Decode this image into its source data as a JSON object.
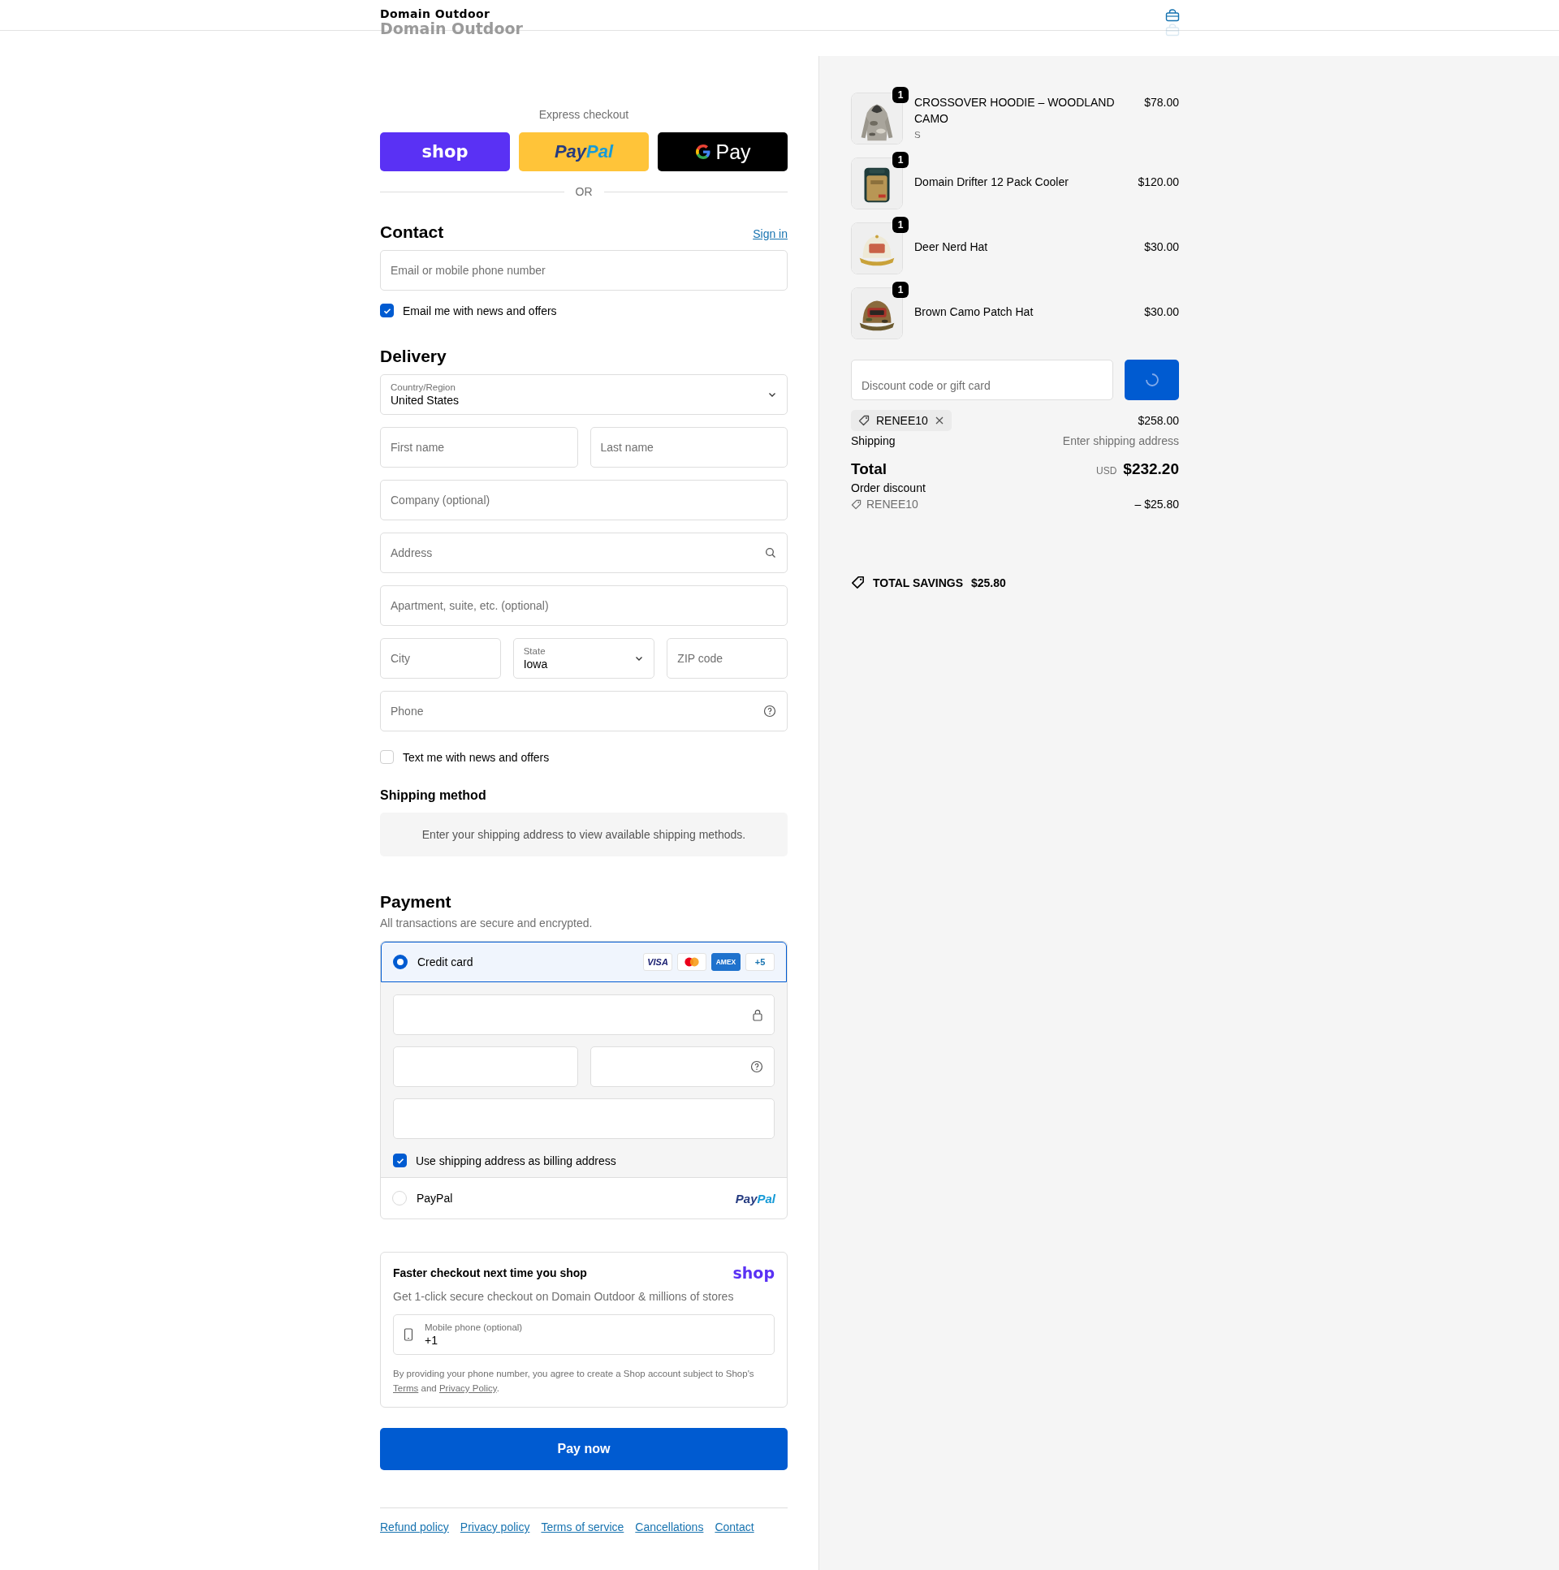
{
  "header": {
    "store_name": "Domain Outdoor",
    "ghost_store_name": "Domain Outdoor"
  },
  "express": {
    "label": "Express checkout",
    "divider": "OR",
    "buttons": [
      {
        "kind": "shop",
        "label": "shop"
      },
      {
        "kind": "paypal",
        "label": "Pay",
        "label_light": "Pal"
      },
      {
        "kind": "gpay",
        "label": "Pay"
      }
    ]
  },
  "contact": {
    "heading": "Contact",
    "sign_in": "Sign in",
    "email": {
      "placeholder": "Email or mobile phone number"
    },
    "news": {
      "label": "Email me with news and offers",
      "checked": true
    }
  },
  "delivery": {
    "heading": "Delivery",
    "rows": [
      [
        {
          "kind": "select",
          "label": "Country/Region",
          "value": "United States"
        }
      ],
      [
        {
          "kind": "text",
          "placeholder": "First name"
        },
        {
          "kind": "text",
          "placeholder": "Last name"
        }
      ],
      [
        {
          "kind": "text",
          "placeholder": "Company (optional)"
        }
      ],
      [
        {
          "kind": "search",
          "placeholder": "Address"
        }
      ],
      [
        {
          "kind": "text",
          "placeholder": "Apartment, suite, etc. (optional)"
        }
      ],
      [
        {
          "kind": "text",
          "placeholder": "City"
        },
        {
          "kind": "select",
          "label": "State",
          "value": "Iowa"
        },
        {
          "kind": "text",
          "placeholder": "ZIP code"
        }
      ],
      [
        {
          "kind": "help",
          "placeholder": "Phone"
        }
      ]
    ],
    "text_me": {
      "label": "Text me with news and offers",
      "checked": false
    }
  },
  "shipping_method": {
    "heading": "Shipping method",
    "notice": "Enter your shipping address to view available shipping methods."
  },
  "payment": {
    "heading": "Payment",
    "subtitle": "All transactions are secure and encrypted.",
    "methods": [
      {
        "kind": "card",
        "label": "Credit card",
        "selected": true,
        "brands": [
          {
            "kind": "visa",
            "label": "VISA"
          },
          {
            "kind": "mastercard"
          },
          {
            "kind": "amex",
            "label": "AMEX"
          },
          {
            "kind": "more",
            "label": "+5"
          }
        ]
      },
      {
        "kind": "paypal",
        "label": "PayPal",
        "selected": false,
        "logo": "Pay",
        "logo_light": "Pal"
      }
    ],
    "billing": {
      "label": "Use shipping address as billing address",
      "checked": true
    }
  },
  "shop_pay": {
    "title": "Faster checkout next time you shop",
    "logo": "shop",
    "subtitle": "Get 1-click secure checkout on Domain Outdoor & millions of stores",
    "phone": {
      "label": "Mobile phone (optional)",
      "value": "+1"
    },
    "legal": "By providing your phone number, you agree to create a Shop account subject to Shop's",
    "terms": "Terms",
    "and": "and",
    "privacy": "Privacy Policy",
    "end": "."
  },
  "pay_button": "Pay now",
  "footer_links": [
    "Refund policy",
    "Privacy policy",
    "Terms of service",
    "Cancellations",
    "Contact"
  ],
  "summary": {
    "items": [
      {
        "name": "CROSSOVER HOODIE – WOODLAND CAMO",
        "variant": "S",
        "price": "$78.00",
        "quantity": "1"
      },
      {
        "name": "Domain Drifter 12 Pack Cooler",
        "price": "$120.00",
        "quantity": "1"
      },
      {
        "name": "Deer Nerd Hat",
        "price": "$30.00",
        "quantity": "1"
      },
      {
        "name": "Brown Camo Patch Hat",
        "price": "$30.00",
        "quantity": "1"
      }
    ],
    "discount": {
      "placeholder": "Discount code or gift card"
    },
    "applied_code": "RENEE10",
    "subtotal": "$258.00",
    "shipping_label": "Shipping",
    "shipping_value": "Enter shipping address",
    "total_label": "Total",
    "currency": "USD",
    "total": "$232.20",
    "order_discount_label": "Order discount",
    "discount_code": "RENEE10",
    "discount_amount": "– $25.80",
    "savings_label": "TOTAL SAVINGS",
    "savings_amount": "$25.80"
  }
}
